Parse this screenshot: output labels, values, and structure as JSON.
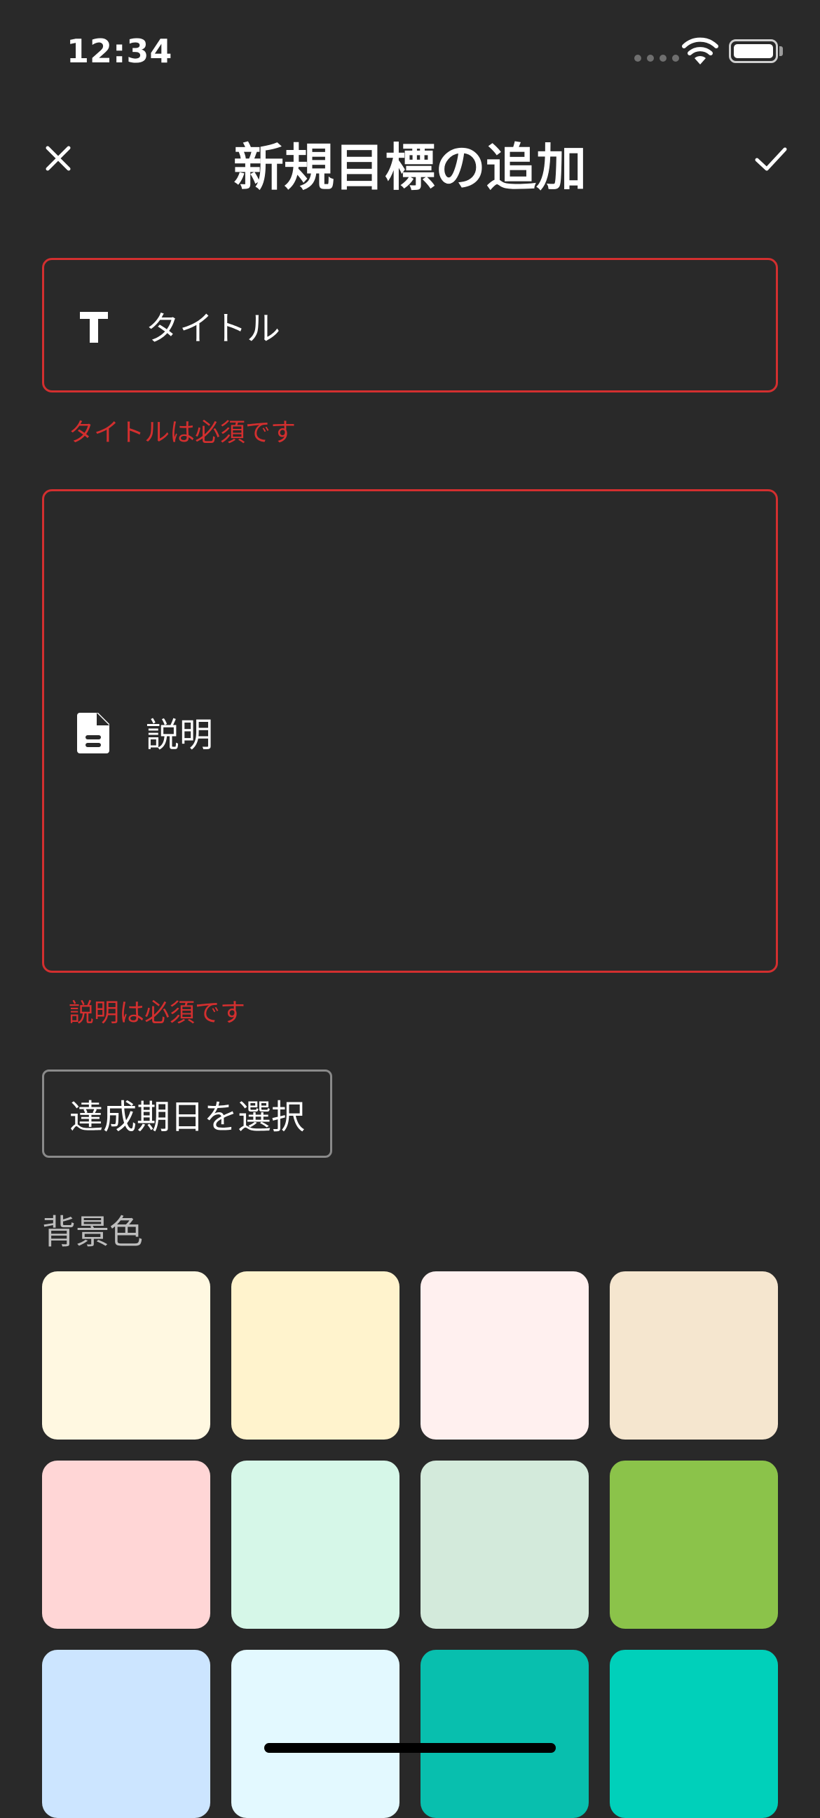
{
  "status_bar": {
    "time": "12:34"
  },
  "header": {
    "title": "新規目標の追加"
  },
  "title_field": {
    "label": "タイトル",
    "error": "タイトルは必須です",
    "icon": "text-icon"
  },
  "description_field": {
    "label": "説明",
    "error": "説明は必須です",
    "icon": "document-icon"
  },
  "date_button": {
    "label": "達成期日を選択"
  },
  "background_color": {
    "label": "背景色",
    "swatches": [
      "#FFF8E1",
      "#FFF3CD",
      "#FFF0EF",
      "#F5E6CF",
      "#FFD6D6",
      "#D6F7E8",
      "#D3EADB",
      "#8BC34A",
      "#CCE5FF",
      "#E3F9FF",
      "#08BFAE",
      "#00D0BA"
    ]
  },
  "colors": {
    "error": "#D32F2F",
    "background": "#292929",
    "border": "#8A8A8A"
  }
}
